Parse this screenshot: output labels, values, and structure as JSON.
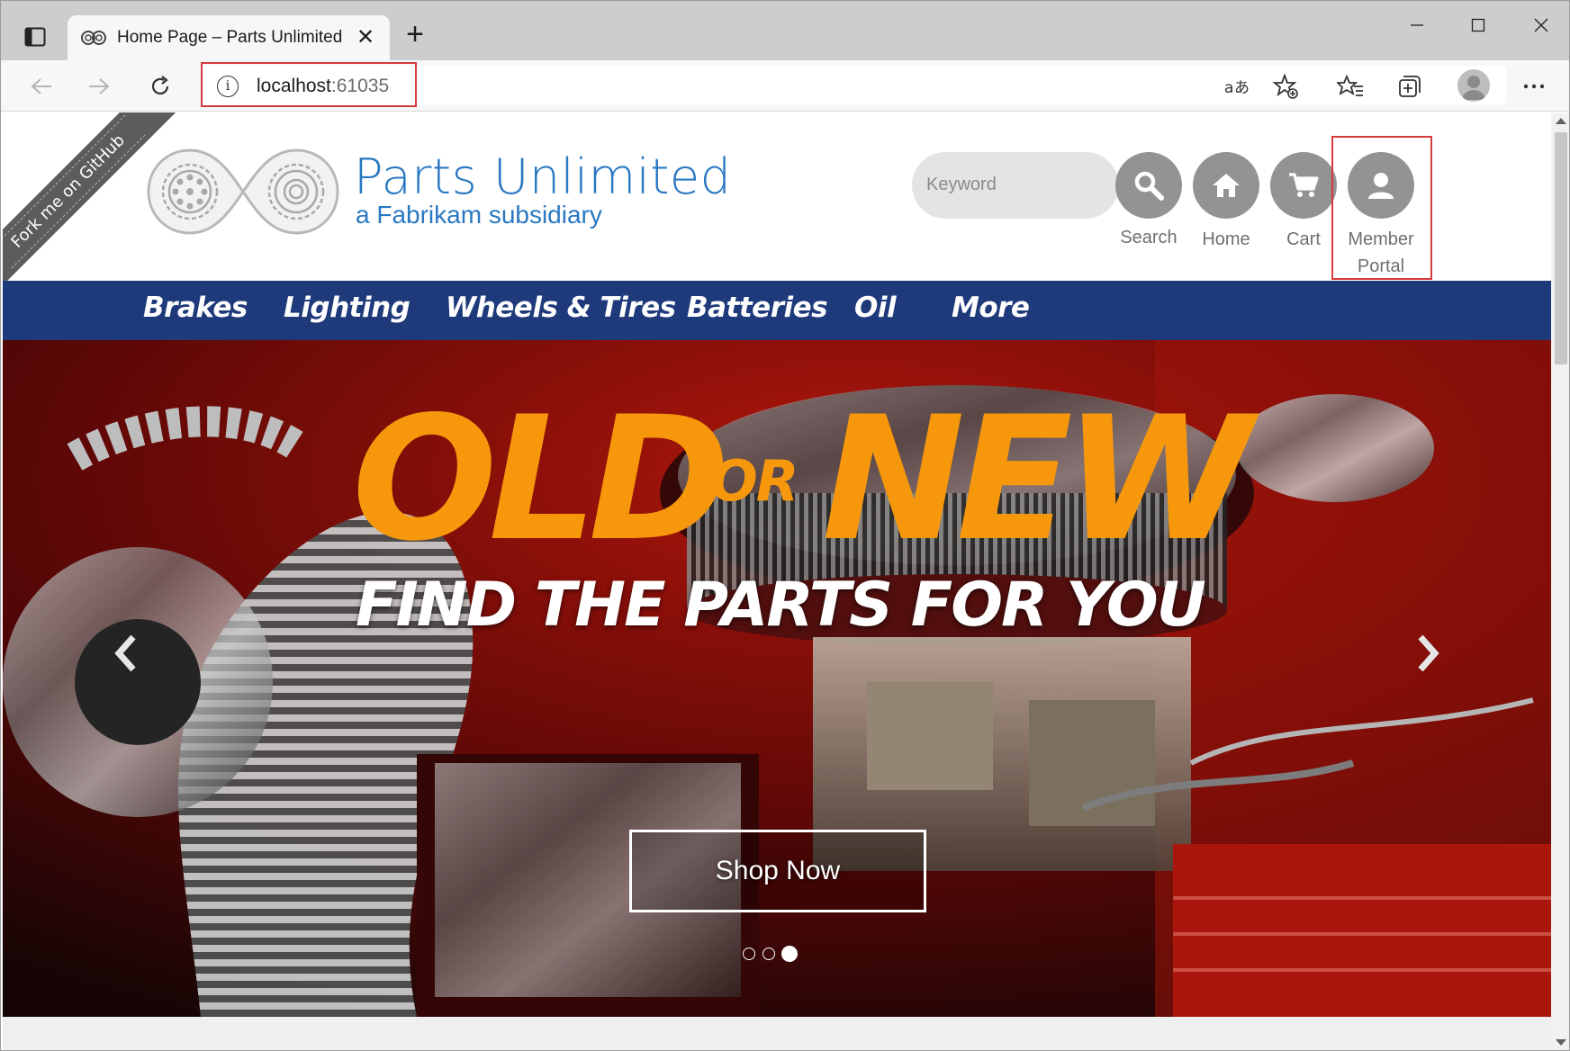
{
  "browser": {
    "tab_title": "Home Page – Parts Unlimited",
    "url_host": "localhost",
    "url_port": ":61035"
  },
  "header": {
    "ribbon_text": "Fork me on GitHub",
    "brand_title": "Parts Unlimited",
    "brand_subtitle": "a Fabrikam subsidiary",
    "search_placeholder": "Keyword",
    "search_label": "Search",
    "home_label": "Home",
    "cart_label": "Cart",
    "member_label_line1": "Member",
    "member_label_line2": "Portal"
  },
  "categories": [
    "Brakes",
    "Lighting",
    "Wheels & Tires",
    "Batteries",
    "Oil",
    "More"
  ],
  "hero": {
    "word_old": "OLD",
    "word_or": "OR",
    "word_new": "NEW",
    "subtitle": "FIND THE PARTS FOR YOU",
    "cta": "Shop Now",
    "slide_count": 3,
    "active_slide": 3
  },
  "colors": {
    "brand_blue": "#2a78c2",
    "nav_bg": "#1e3a7a",
    "hero_accent": "#f7980c",
    "highlight_red": "#d63b3b"
  }
}
